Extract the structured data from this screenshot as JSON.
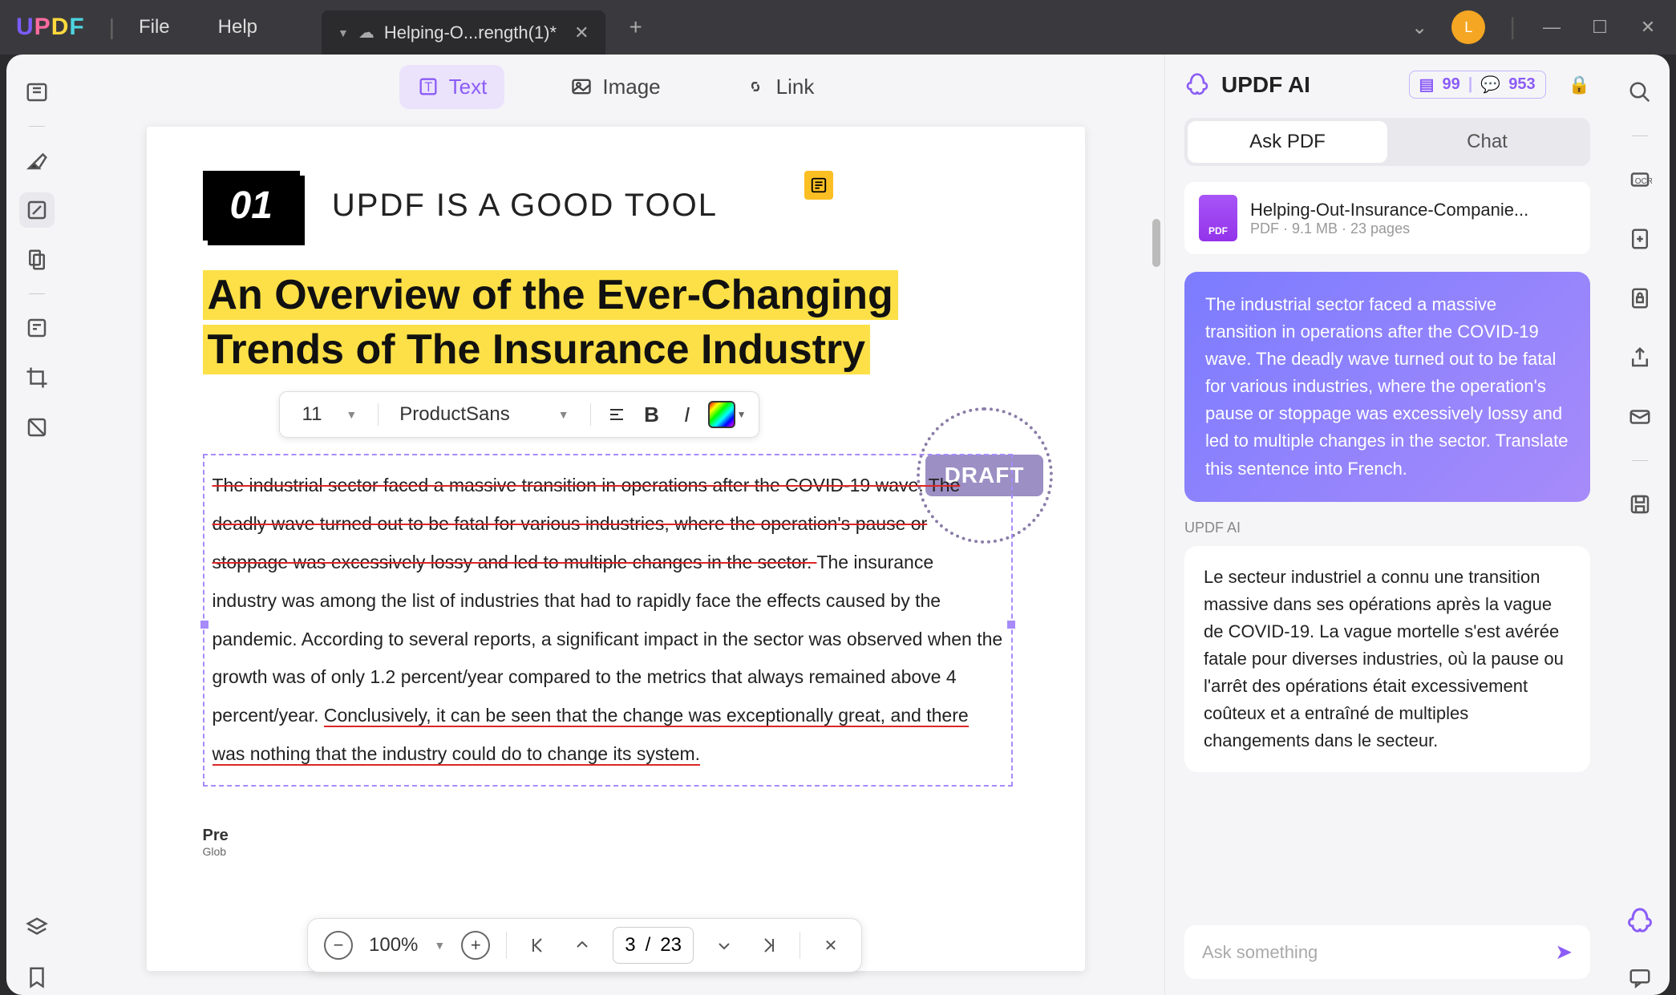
{
  "titlebar": {
    "menu_file": "File",
    "menu_help": "Help",
    "tab_title": "Helping-O...rength(1)*",
    "avatar_initial": "L"
  },
  "toolbar": {
    "text": "Text",
    "image": "Image",
    "link": "Link"
  },
  "format": {
    "size": "11",
    "font": "ProductSans"
  },
  "page": {
    "badge": "01",
    "header": "UPDF IS A GOOD TOOL",
    "title_line1": "An Overview of the Ever-Changing",
    "title_line2": "Trends of The Insurance Industry",
    "draft": "DRAFT",
    "body_struck": "The industrial sector faced a massive transition in operations after the COVID-19 wave. The deadly wave turned out to be fatal for various industries, where the operation's pause or stoppage was excessively lossy and led to multiple changes in the sector. ",
    "body_rest": "The insurance industry was among the list of industries that had to rapidly face the effects caused by the pandemic. According to several reports, a significant impact in the sector was observed when the growth was of only 1.2 percent/year compared to the metrics that always remained above 4 percent/year. ",
    "body_tail": "Conclusively, it can be seen that the change was exceptionally great, and there was nothing that the industry could do to change its system.",
    "footer": "Pre",
    "footer_sub": "Glob"
  },
  "zoom": {
    "value": "100%",
    "current_page": "3",
    "sep": "/",
    "total_pages": "23"
  },
  "ai": {
    "title": "UPDF AI",
    "count1": "99",
    "count2": "953",
    "tab_ask": "Ask PDF",
    "tab_chat": "Chat",
    "file_name": "Helping-Out-Insurance-Companie...",
    "file_meta": "PDF · 9.1 MB · 23 pages",
    "file_icon_label": "PDF",
    "user_msg": "The industrial sector faced a massive transition in operations after the COVID-19 wave. The deadly wave turned out to be fatal for various industries, where the operation's pause or stoppage was excessively lossy and led to multiple changes in the sector.  Translate this sentence into French.",
    "label": "UPDF AI",
    "response": "Le secteur industriel a connu une transition massive dans ses opérations après la vague de COVID-19. La vague mortelle s'est avérée fatale pour diverses industries, où la pause ou l'arrêt des opérations était excessivement coûteux et a entraîné de multiples changements dans le secteur.",
    "input_placeholder": "Ask something"
  }
}
